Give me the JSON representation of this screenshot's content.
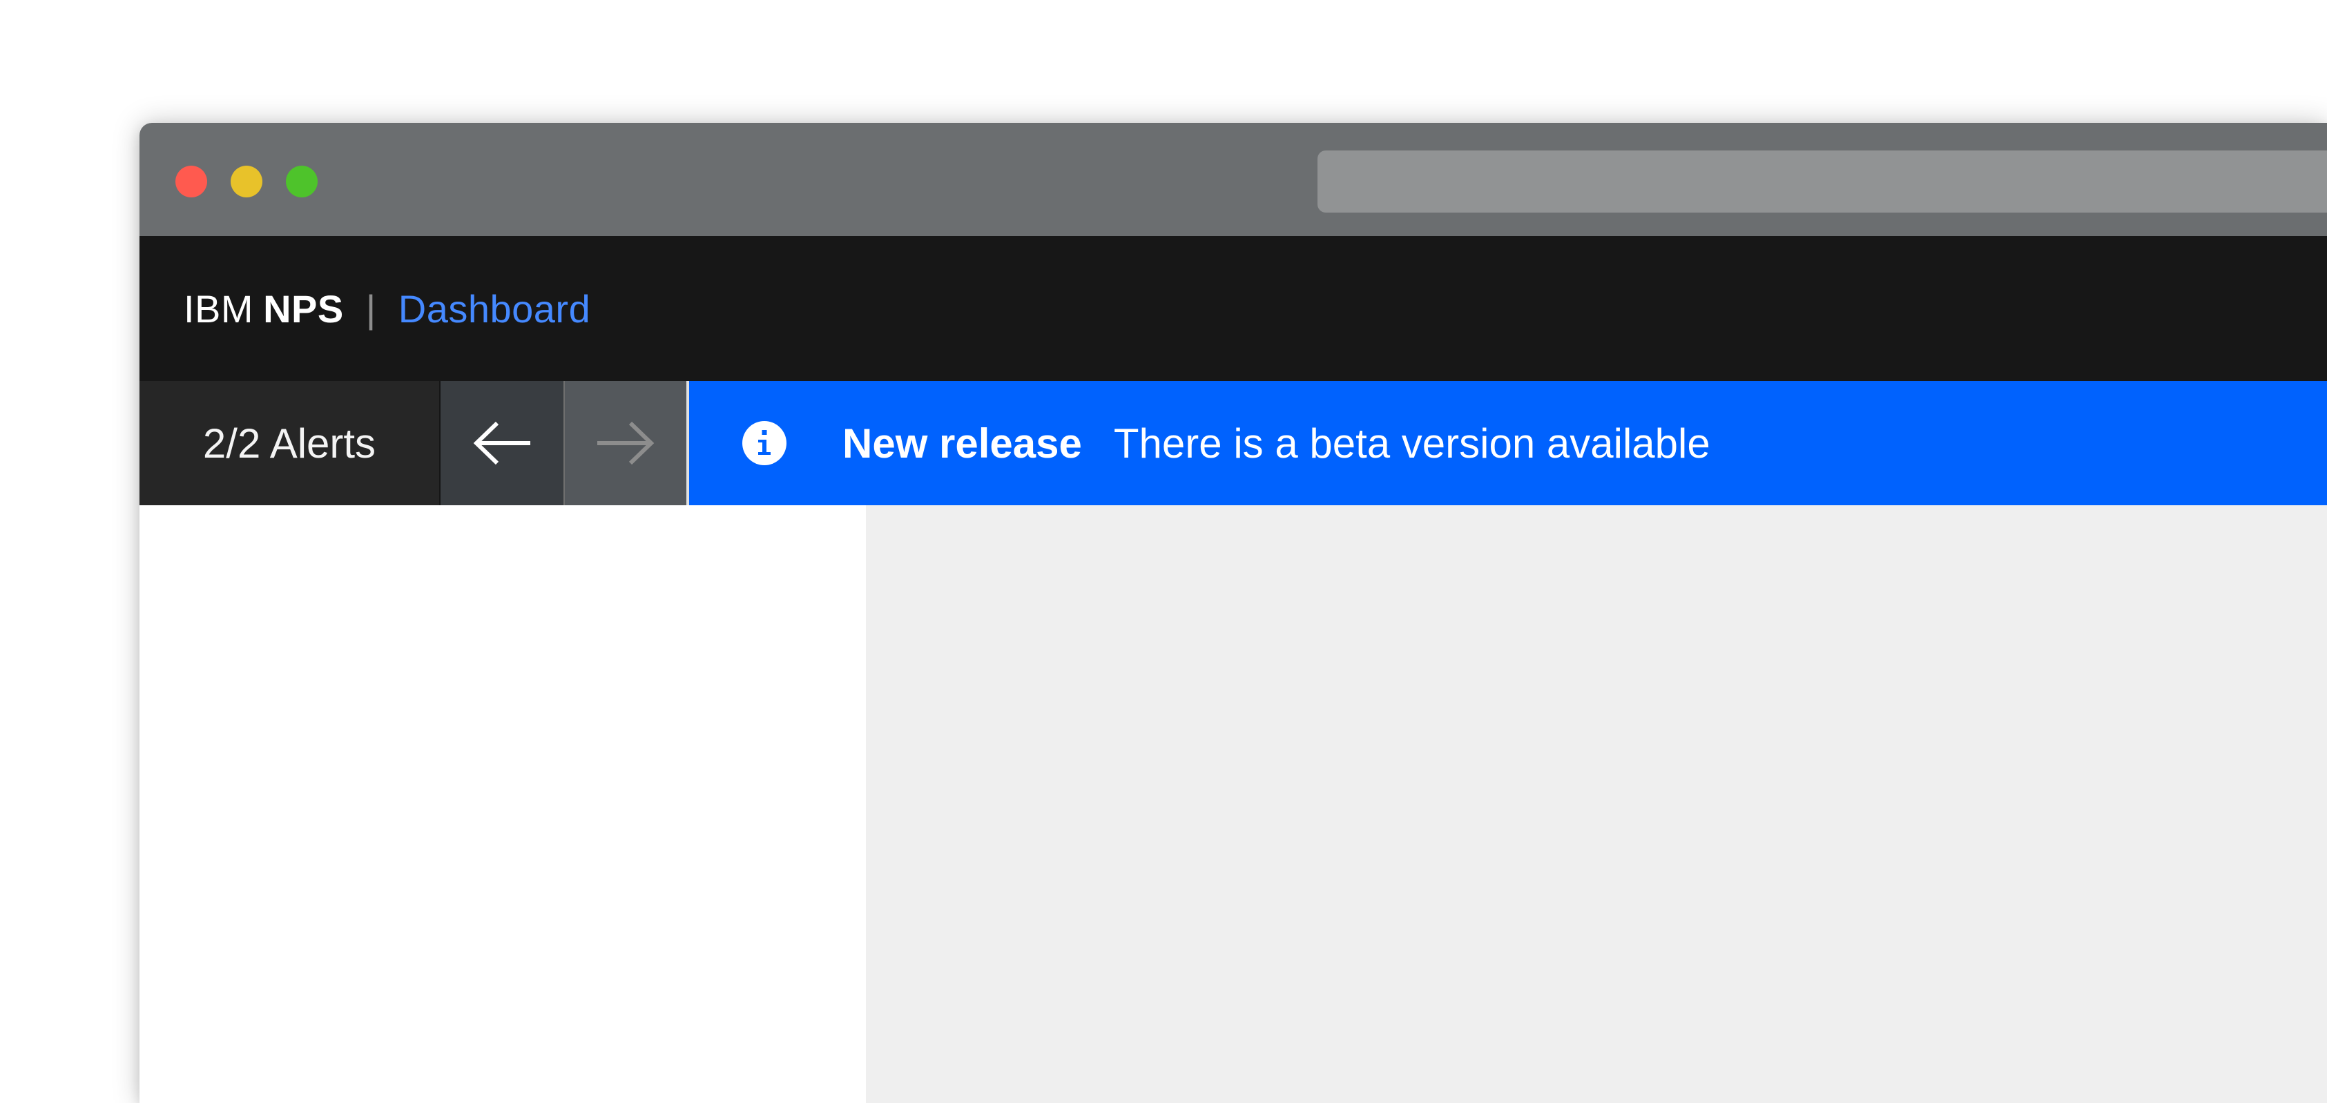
{
  "header": {
    "brand_company": "IBM",
    "brand_product": "NPS",
    "separator": "|",
    "breadcrumb": "Dashboard"
  },
  "alerts": {
    "count_label": "2/2 Alerts",
    "prev_icon": "arrow-left-icon",
    "next_icon": "arrow-right-icon"
  },
  "notification": {
    "icon": "info-icon",
    "title": "New release",
    "message": "There is a beta version available"
  },
  "colors": {
    "notification_bg": "#0062fe",
    "breadcrumb": "#4589ff",
    "header_bg": "#171717",
    "titlebar_bg": "#6b6e70"
  }
}
